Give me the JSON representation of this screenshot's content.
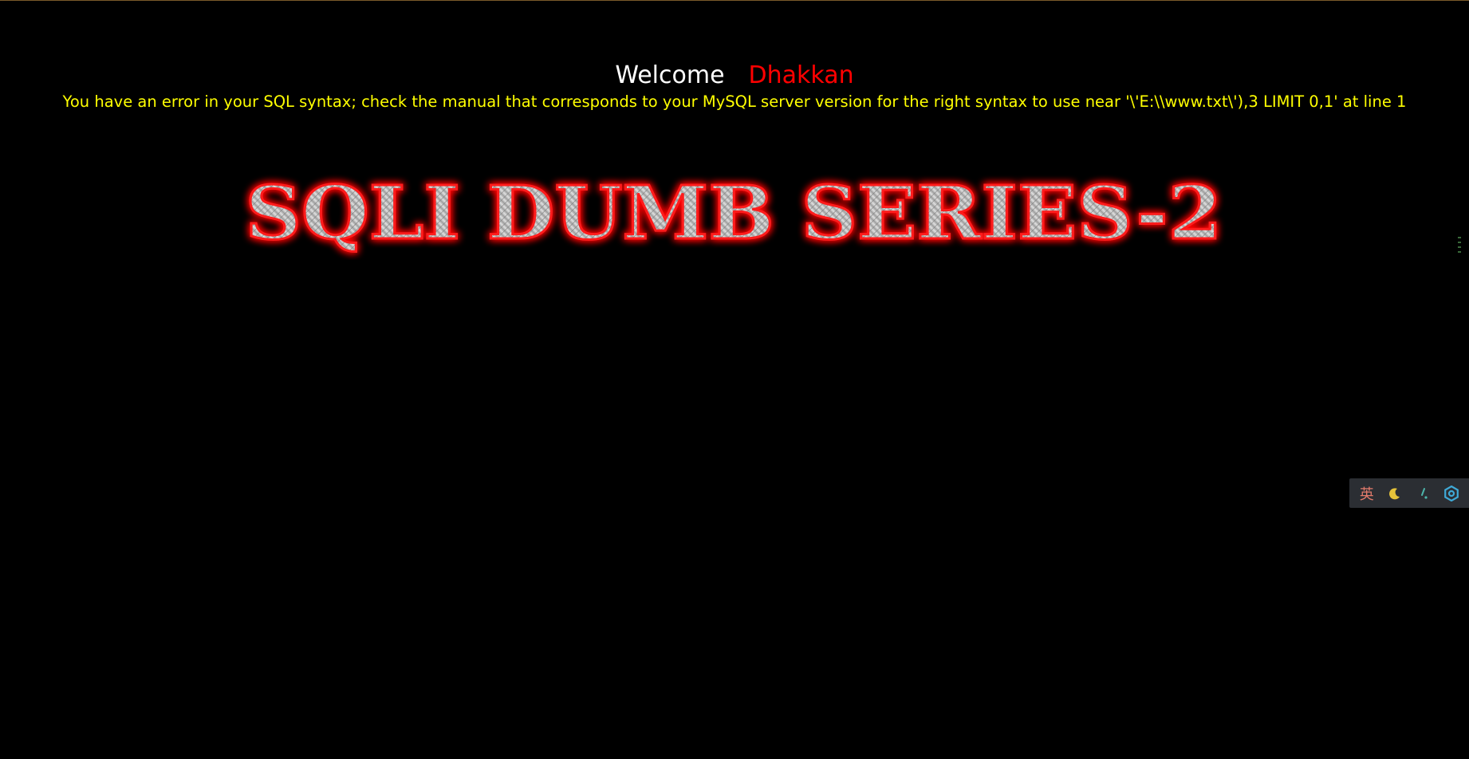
{
  "header": {
    "welcome_label": "Welcome",
    "user_name": "Dhakkan"
  },
  "message": {
    "sql_error": "You have an error in your SQL syntax; check the manual that corresponds to your MySQL server version for the right syntax to use near '\\'E:\\\\www.txt\\'),3 LIMIT 0,1' at line 1"
  },
  "banner": {
    "title": "SQLI DUMB SERIES-2"
  },
  "ime_toolbar": {
    "language_label": "英",
    "icons": [
      "moon-icon",
      "punctuation-icon",
      "settings-gear-icon"
    ]
  },
  "colors": {
    "background": "#000000",
    "welcome": "#ffffff",
    "user_name": "#ff0000",
    "error_text": "#ffff00",
    "banner_glow": "#ff0000",
    "toolbar_bg": "#2b2e33"
  }
}
